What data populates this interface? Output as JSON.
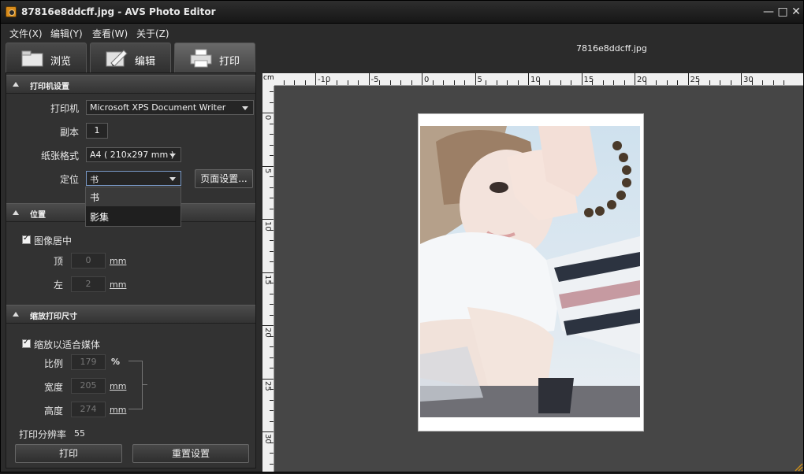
{
  "window": {
    "title": "87816e8ddcff.jpg  -  AVS Photo Editor"
  },
  "menu": [
    "文件(X)",
    "编辑(Y)",
    "查看(W)",
    "关于(Z)"
  ],
  "file_caption": "7816e8ddcff.jpg",
  "tabs": [
    {
      "label": "浏览"
    },
    {
      "label": "编辑"
    },
    {
      "label": "打印",
      "active": true
    }
  ],
  "printer_section": {
    "title": "打印机设置",
    "printer_label": "打印机",
    "printer_value": "Microsoft XPS Document Writer",
    "copies_label": "副本",
    "copies_value": "1",
    "paper_label": "纸张格式",
    "paper_value": "A4 ( 210x297 mm )",
    "orientation_label": "定位",
    "orientation_value": "书",
    "page_setup_button": "页面设置...",
    "orientation_options": [
      "书",
      "影集"
    ]
  },
  "position_section": {
    "title": "位置",
    "center_label": "图像居中",
    "top_label": "顶",
    "top_value": "0",
    "left_label": "左",
    "left_value": "2",
    "unit": "mm"
  },
  "scale_section": {
    "title": "缩放打印尺寸",
    "fit_label": "缩放以适合媒体",
    "ratio_label": "比例",
    "ratio_value": "179",
    "ratio_unit": "%",
    "width_label": "宽度",
    "width_value": "205",
    "height_label": "高度",
    "height_value": "274",
    "unit": "mm",
    "resolution_label": "打印分辨率",
    "resolution_value": "55"
  },
  "bottom_buttons": {
    "print": "打印",
    "reset": "重置设置"
  },
  "ruler": {
    "unit": "cm",
    "top_labels": [
      "-10",
      "-5",
      "0",
      "5",
      "10",
      "15",
      "20",
      "25",
      "30"
    ],
    "left_labels": [
      "0",
      "5",
      "10",
      "15",
      "20",
      "25",
      "30"
    ]
  }
}
